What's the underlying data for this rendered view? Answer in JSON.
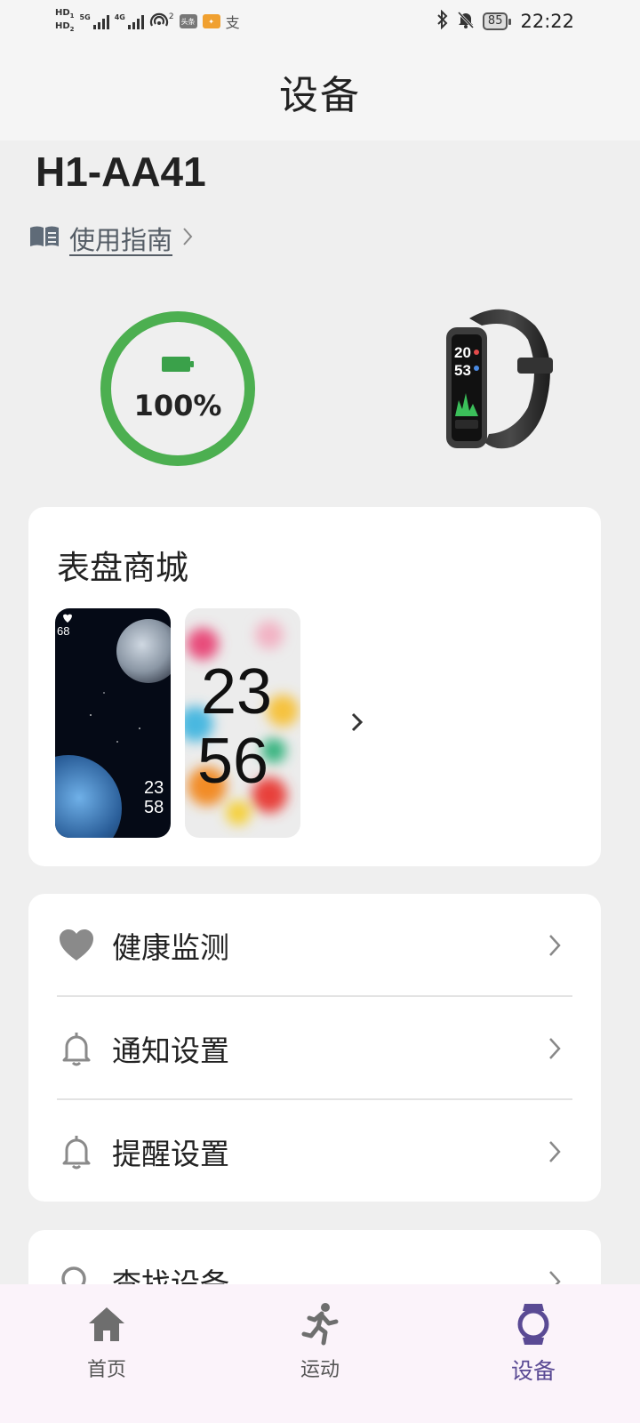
{
  "status_bar": {
    "hd1": "HD",
    "hd1_sub": "1",
    "hd2": "HD",
    "hd2_sub": "2",
    "net1": "5G",
    "net2": "4G",
    "hotspot_sup": "2",
    "app1_label": "头条",
    "app2_label": "✦",
    "app3_label": "支",
    "battery": "85",
    "time": "22:22"
  },
  "header": {
    "title": "设备"
  },
  "device": {
    "name": "H1-AA41",
    "guide_label": "使用指南",
    "battery_percent_text": "100%",
    "battery_level": 100,
    "ring_color": "#4caf50"
  },
  "band_screen": {
    "line1": "20",
    "line2": "53"
  },
  "store": {
    "title": "表盘商城",
    "faces": [
      {
        "name": "space",
        "heart_value": "68",
        "time_hour": "23",
        "time_min": "58"
      },
      {
        "name": "colorful",
        "time_hour": "23",
        "time_min": "56"
      }
    ]
  },
  "settings": {
    "rows": [
      {
        "label": "健康监测",
        "icon": "heart-icon"
      },
      {
        "label": "通知设置",
        "icon": "bell-icon"
      },
      {
        "label": "提醒设置",
        "icon": "bell-icon"
      }
    ]
  },
  "find": {
    "label": "查找设备",
    "icon": "search-icon"
  },
  "nav": {
    "items": [
      {
        "label": "首页",
        "icon": "home-icon",
        "active": false
      },
      {
        "label": "运动",
        "icon": "running-icon",
        "active": false
      },
      {
        "label": "设备",
        "icon": "watch-icon",
        "active": true
      }
    ]
  },
  "colors": {
    "accent": "#5a4a94",
    "battery_green": "#4caf50",
    "background": "#efefef",
    "nav_background": "#fbf3fa"
  }
}
